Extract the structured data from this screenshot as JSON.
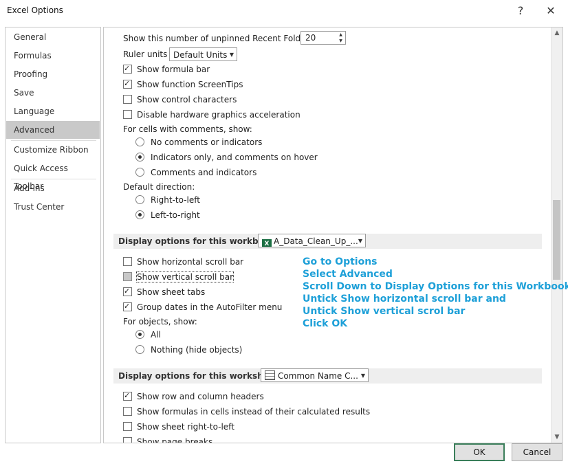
{
  "window": {
    "title": "Excel Options",
    "help": "?",
    "close": "✕"
  },
  "sidebar": {
    "items": [
      {
        "label": "General"
      },
      {
        "label": "Formulas"
      },
      {
        "label": "Proofing"
      },
      {
        "label": "Save"
      },
      {
        "label": "Language"
      },
      {
        "label": "Advanced",
        "selected": true
      },
      {
        "label": "Customize Ribbon"
      },
      {
        "label": "Quick Access Toolbar"
      },
      {
        "label": "Add-ins"
      },
      {
        "label": "Trust Center"
      }
    ]
  },
  "display": {
    "recent_folders_label": "Show this number of unpinned Recent Folders:",
    "recent_folders_value": "20",
    "ruler_units_label": "Ruler units",
    "ruler_units_value": "Default Units",
    "show_formula_bar": "Show formula bar",
    "show_screentips": "Show function ScreenTips",
    "show_control_chars": "Show control characters",
    "disable_hw_accel": "Disable hardware graphics acceleration",
    "comments_label": "For cells with comments, show:",
    "no_comments": "No comments or indicators",
    "indicators_only": "Indicators only, and comments on hover",
    "comments_and_indicators": "Comments and indicators",
    "default_direction_label": "Default direction:",
    "rtl": "Right-to-left",
    "ltr": "Left-to-right"
  },
  "workbook": {
    "section_label": "Display options for this workbook:",
    "selected_workbook": "A_Data_Clean_Up_...",
    "show_hscroll": "Show horizontal scroll bar",
    "show_vscroll": "Show vertical scroll bar",
    "show_sheet_tabs": "Show sheet tabs",
    "group_dates": "Group dates in the AutoFilter menu",
    "objects_label": "For objects, show:",
    "all": "All",
    "nothing": "Nothing (hide objects)"
  },
  "worksheet": {
    "section_label": "Display options for this worksheet:",
    "selected_sheet": "Common Name C...",
    "show_headers": "Show row and column headers",
    "show_formulas": "Show formulas in cells instead of their calculated results",
    "show_rtl": "Show sheet right-to-left",
    "show_page_breaks_partial": "Show page breaks"
  },
  "annotation": {
    "lines": [
      "Go to Options",
      "Select Advanced",
      "Scroll Down to Display Options for this Workbook",
      "Untick Show horizontal scroll bar and",
      "Untick Show vertical scrol bar",
      "Click OK"
    ]
  },
  "buttons": {
    "ok": "OK",
    "cancel": "Cancel"
  },
  "colors": {
    "annotation": "#1ea0d8",
    "selected_nav": "#c9c9c9",
    "excel_green": "#1d7044"
  },
  "icons": {
    "workbook": "excel-icon",
    "worksheet": "sheet-icon"
  }
}
